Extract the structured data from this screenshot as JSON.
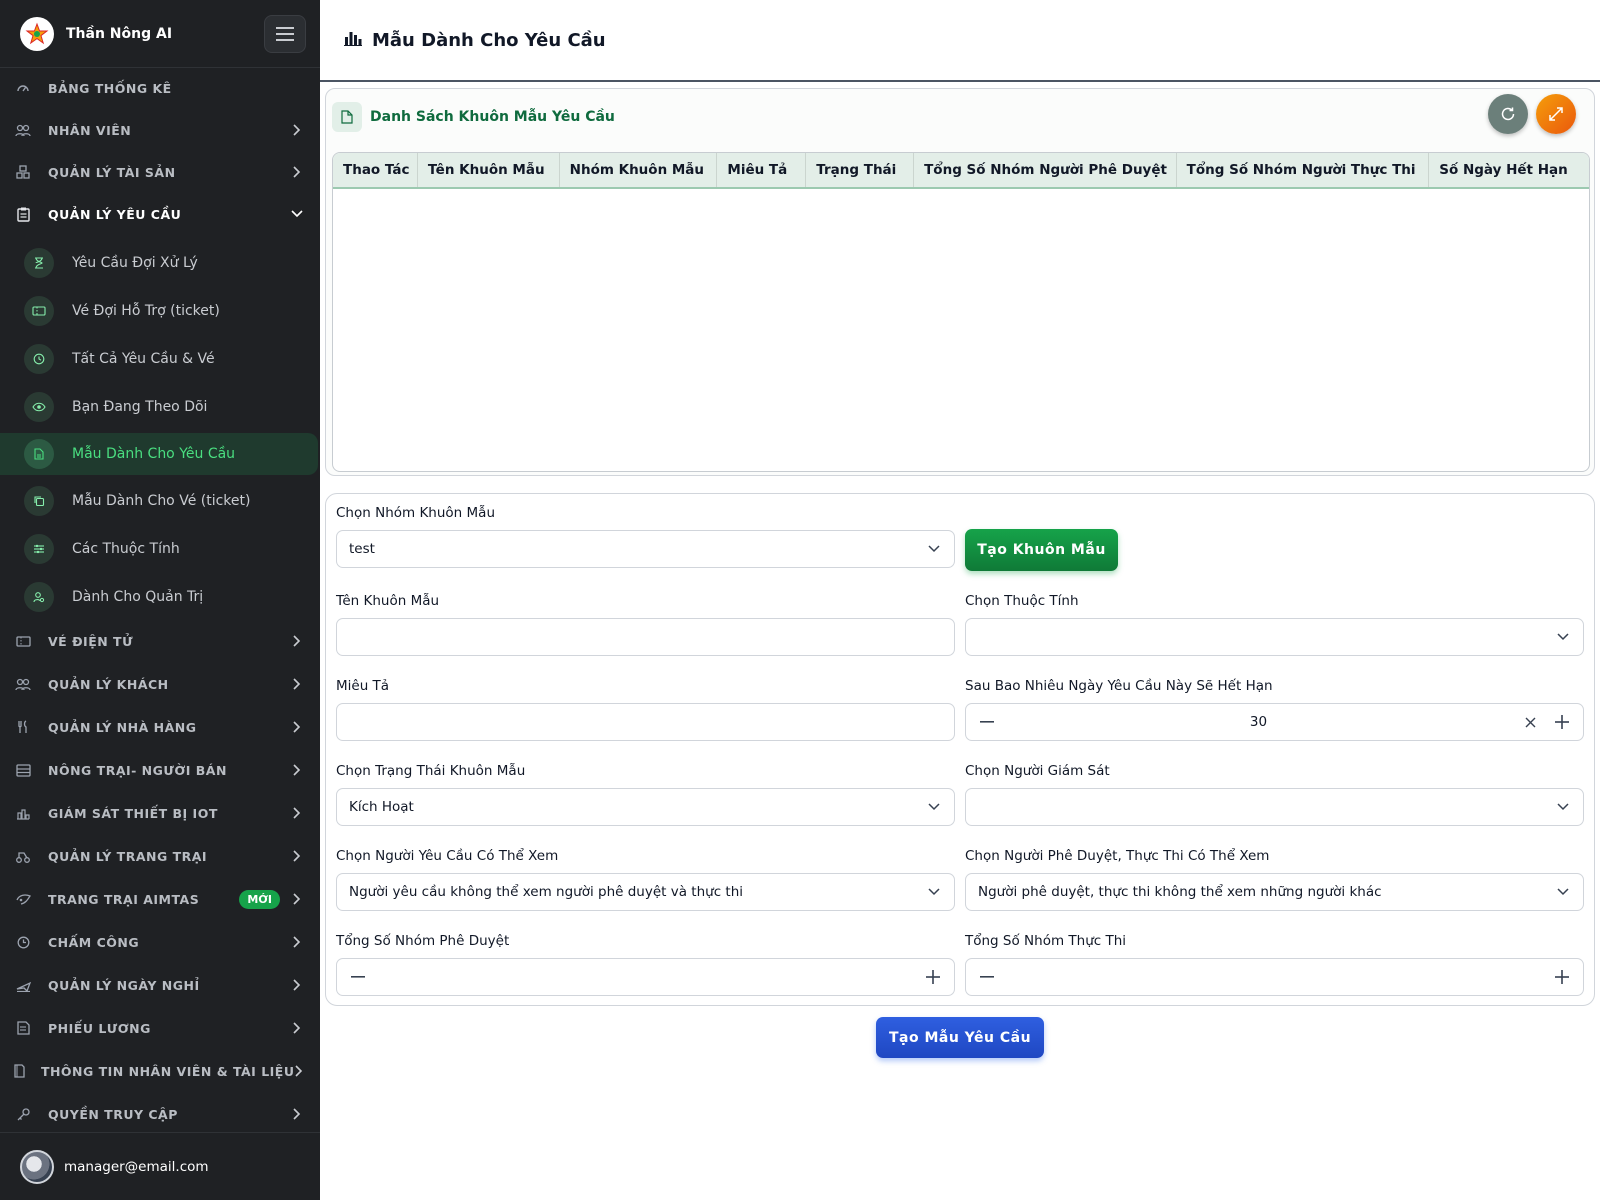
{
  "sidebar": {
    "brand": "Thần Nông AI",
    "nav": [
      {
        "label": "BẢNG THỐNG KÊ",
        "icon": "dashboard-icon"
      },
      {
        "label": "NHÂN VIÊN",
        "icon": "employees-icon"
      },
      {
        "label": "QUẢN LÝ TÀI SẢN",
        "icon": "assets-icon"
      },
      {
        "label": "QUẢN LÝ YÊU CẦU",
        "icon": "clipboard-icon"
      },
      {
        "label": "VÉ ĐIỆN TỬ",
        "icon": "ticket-icon"
      },
      {
        "label": "QUẢN LÝ KHÁCH",
        "icon": "guests-icon"
      },
      {
        "label": "QUẢN LÝ NHÀ HÀNG",
        "icon": "restaurant-icon"
      },
      {
        "label": "NÔNG TRẠI- NGƯỜI BÁN",
        "icon": "farm-seller-icon"
      },
      {
        "label": "GIÁM SÁT THIẾT BỊ IOT",
        "icon": "iot-icon"
      },
      {
        "label": "QUẢN LÝ TRANG TRẠI",
        "icon": "farm-icon"
      },
      {
        "label": "TRANG TRẠI AIMTAS",
        "icon": "aimtas-icon",
        "badge": "MỚI"
      },
      {
        "label": "CHẤM CÔNG",
        "icon": "clock-icon"
      },
      {
        "label": "QUẢN LÝ NGÀY NGHỈ",
        "icon": "leave-icon"
      },
      {
        "label": "PHIẾU LƯƠNG",
        "icon": "payslip-icon"
      },
      {
        "label": "THÔNG TIN NHÂN VIÊN & TÀI LIỆU",
        "icon": "documents-icon"
      },
      {
        "label": "QUYỀN TRUY CẬP",
        "icon": "key-icon"
      }
    ],
    "sub": [
      {
        "label": "Yêu Cầu Đợi Xử Lý",
        "icon": "hourglass-icon"
      },
      {
        "label": "Vé Đợi Hỗ Trợ (ticket)",
        "icon": "ticket-icon"
      },
      {
        "label": "Tất Cả Yêu Cầu & Vé",
        "icon": "history-icon"
      },
      {
        "label": "Bạn Đang Theo Dõi",
        "icon": "eye-icon"
      },
      {
        "label": "Mẫu Dành Cho Yêu Cầu",
        "icon": "file-icon"
      },
      {
        "label": "Mẫu Dành Cho Vé (ticket)",
        "icon": "copy-icon"
      },
      {
        "label": "Các Thuộc Tính",
        "icon": "sliders-icon"
      },
      {
        "label": "Dành Cho Quản Trị",
        "icon": "admin-icon"
      }
    ],
    "user_email": "manager@email.com"
  },
  "header": {
    "title": "Mẫu Dành Cho Yêu Cầu"
  },
  "table_card": {
    "title": "Danh Sách Khuôn Mẫu Yêu Cầu",
    "columns": [
      "Thao Tác",
      "Tên Khuôn Mẫu",
      "Nhóm Khuôn Mẫu",
      "Miêu Tả",
      "Trạng Thái",
      "Tổng Số Nhóm Người Phê Duyệt",
      "Tổng Số Nhóm Người Thực Thi",
      "Số Ngày Hết Hạn"
    ],
    "rows": []
  },
  "form": {
    "group_label": "Chọn Nhóm Khuôn Mẫu",
    "group_value": "test",
    "create_group_button": "Tạo Khuôn Mẫu",
    "name_label": "Tên Khuôn Mẫu",
    "name_value": "",
    "attribute_label": "Chọn Thuộc Tính",
    "attribute_value": "",
    "description_label": "Miêu Tả",
    "description_value": "",
    "expiry_label": "Sau Bao Nhiêu Ngày Yêu Cầu Này Sẽ Hết Hạn",
    "expiry_value": "30",
    "status_label": "Chọn Trạng Thái Khuôn Mẫu",
    "status_value": "Kích Hoạt",
    "supervisor_label": "Chọn Người Giám Sát",
    "supervisor_value": "",
    "requester_view_label": "Chọn Người Yêu Cầu Có Thể Xem",
    "requester_view_value": "Người yêu cầu không thể xem người phê duyệt và thực thi",
    "approver_view_label": "Chọn Người Phê Duyệt, Thực Thi Có Thể Xem",
    "approver_view_value": "Người phê duyệt, thực thi không thể xem những người khác",
    "approval_groups_label": "Tổng Số Nhóm Phê Duyệt",
    "approval_groups_value": "",
    "execution_groups_label": "Tổng Số Nhóm Thực Thi",
    "execution_groups_value": "",
    "submit_button": "Tạo Mẫu Yêu Cầu"
  },
  "colors": {
    "sidebar_bg": "#1f2124",
    "accent_green": "#16a34a",
    "accent_blue": "#2563eb",
    "active_text": "#4ade80"
  }
}
